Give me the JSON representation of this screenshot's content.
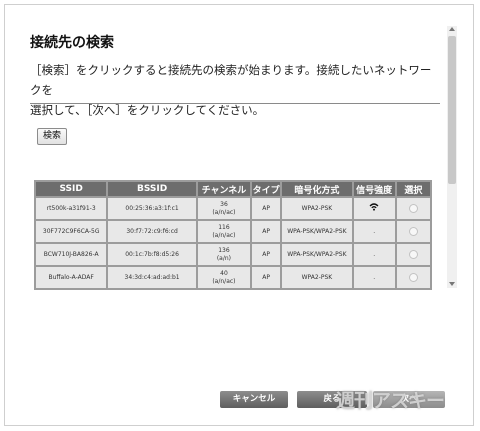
{
  "dialog": {
    "title": "接続先の検索",
    "description_line1": "［検索］をクリックすると接続先の検索が始まります。接続したいネットワークを",
    "description_line2": "選択して、［次へ］をクリックしてください。",
    "search_button": "検索"
  },
  "table": {
    "headers": [
      "SSID",
      "BSSID",
      "チャンネル",
      "タイプ",
      "暗号化方式",
      "信号強度",
      "選択"
    ],
    "rows": [
      {
        "ssid": "rt500k-a31f91-3",
        "bssid": "00:25:36:a3:1f:c1",
        "channel_line1": "36",
        "channel_line2": "(a/n/ac)",
        "type": "AP",
        "encryption": "WPA2-PSK",
        "signal": "wifi-strong-icon",
        "signal_text": ""
      },
      {
        "ssid": "30F772C9F6CA-5G",
        "bssid": "30:f7:72:c9:f6:cd",
        "channel_line1": "116",
        "channel_line2": "(a/n/ac)",
        "type": "AP",
        "encryption": "WPA-PSK/WPA2-PSK",
        "signal": "dot",
        "signal_text": "."
      },
      {
        "ssid": "BCW710J-BA826-A",
        "bssid": "00:1c:7b:f8:d5:26",
        "channel_line1": "136",
        "channel_line2": "(a/n)",
        "type": "AP",
        "encryption": "WPA-PSK/WPA2-PSK",
        "signal": "dot",
        "signal_text": "."
      },
      {
        "ssid": "Buffalo-A-ADAF",
        "bssid": "34:3d:c4:ad:ad:b1",
        "channel_line1": "40",
        "channel_line2": "(a/n/ac)",
        "type": "AP",
        "encryption": "WPA2-PSK",
        "signal": "dot",
        "signal_text": "."
      }
    ]
  },
  "footer": {
    "cancel": "キャンセル",
    "back": "戻る",
    "next": "次へ"
  },
  "watermark": "週刊アスキー"
}
